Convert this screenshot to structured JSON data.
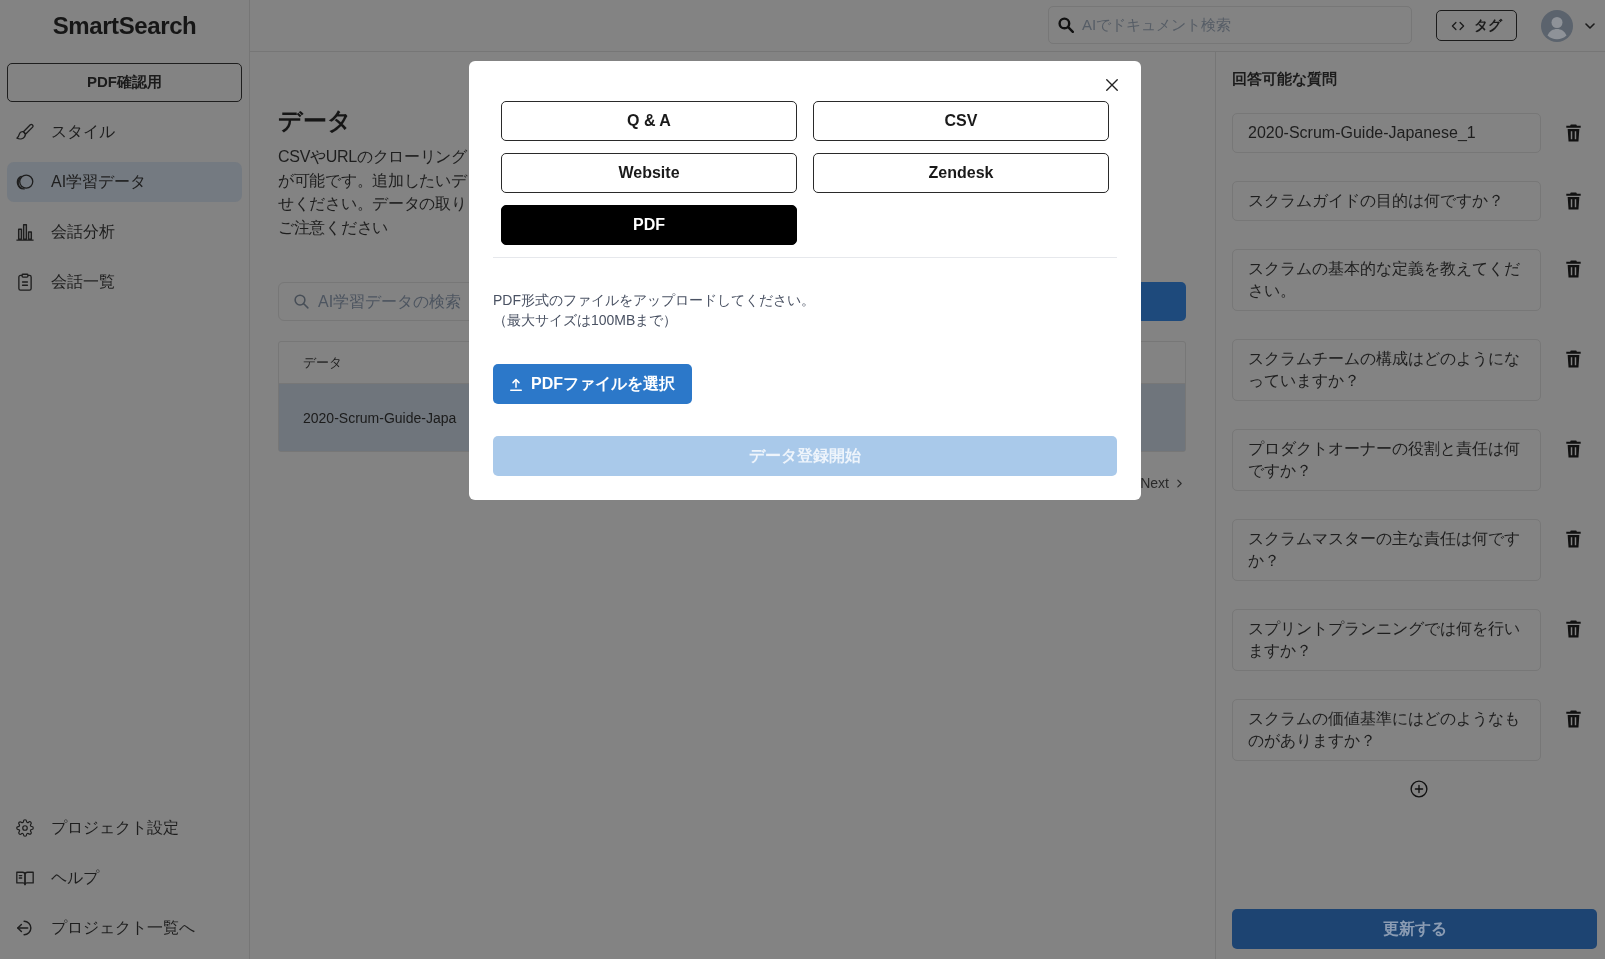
{
  "sidebar": {
    "logo": "SmartSearch",
    "project_button": "PDF確認用",
    "nav_items": [
      {
        "label": "スタイル",
        "selected": false
      },
      {
        "label": "AI学習データ",
        "selected": true
      },
      {
        "label": "会話分析",
        "selected": false
      },
      {
        "label": "会話一覧",
        "selected": false
      }
    ],
    "footer_items": [
      "プロジェクト設定",
      "ヘルプ",
      "プロジェクト一覧へ"
    ]
  },
  "top_bar": {
    "search": {
      "placeholder": "AIでドキュメント検索"
    },
    "tag_button": "タグ"
  },
  "main": {
    "title": "データ",
    "description_lines": [
      "CSVやURLのクローリング",
      "が可能です。追加したいデ",
      "せください。データの取り",
      "ご注意ください"
    ],
    "search": {
      "placeholder": "AI学習データの検索"
    },
    "table": {
      "columns": [
        "データ"
      ],
      "rows": [
        {
          "cells": [
            "2020-Scrum-Guide-Japa"
          ],
          "selected": true
        }
      ]
    },
    "pagination": {
      "next": "Next"
    }
  },
  "modal": {
    "source_types": [
      {
        "label": "Q & A",
        "selected": false
      },
      {
        "label": "CSV",
        "selected": false
      },
      {
        "label": "Website",
        "selected": false
      },
      {
        "label": "Zendesk",
        "selected": false
      },
      {
        "label": "PDF",
        "selected": true
      }
    ],
    "instruction_lines": [
      "PDF形式のファイルをアップロードしてください。",
      "（最大サイズは100MBまで）"
    ],
    "upload_button": "PDFファイルを選択",
    "submit_button": {
      "label": "データ登録開始",
      "disabled": true
    }
  },
  "questions_panel": {
    "title": "回答可能な質問",
    "questions": [
      "2020-Scrum-Guide-Japanese_1",
      "スクラムガイドの目的は何ですか？",
      "スクラムの基本的な定義を教えてください。",
      "スクラムチームの構成はどのようになっていますか？",
      "プロダクトオーナーの役割と責任は何ですか？",
      "スクラムマスターの主な責任は何ですか？",
      "スプリントプランニングでは何を行いますか？",
      "スクラムの価値基準にはどのようなものがありますか？"
    ],
    "update_button": "更新する"
  }
}
